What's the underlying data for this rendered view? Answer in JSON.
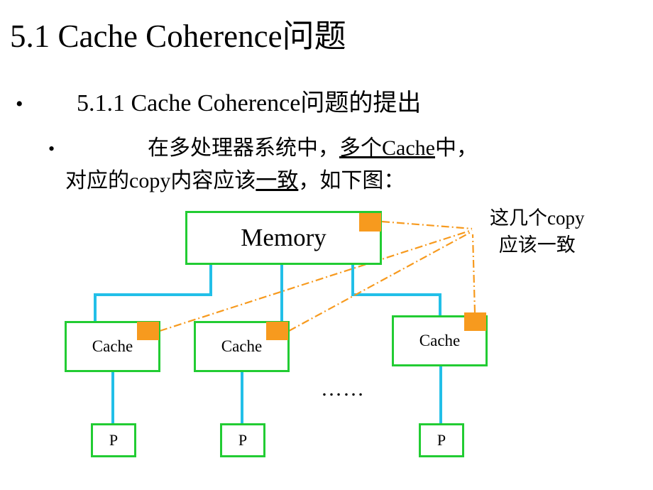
{
  "slide": {
    "title": "5.1 Cache Coherence问题",
    "bullets": [
      {
        "level": 1,
        "marker": "•",
        "text": "5.1.1 Cache Coherence问题的提出"
      },
      {
        "level": 2,
        "marker": "•",
        "line1_a": "在多处理器系统中，",
        "line1_underlined": "多个Cache",
        "line1_b": "中，",
        "line2_a": "对应的copy内容应该",
        "line2_underlined": "一致",
        "line2_b": "，如下图："
      }
    ]
  },
  "diagram": {
    "memory": {
      "label": "Memory"
    },
    "caches": [
      {
        "label": "Cache"
      },
      {
        "label": "Cache"
      },
      {
        "label": "Cache"
      }
    ],
    "processors": [
      {
        "label": "P"
      },
      {
        "label": "P"
      },
      {
        "label": "P"
      }
    ],
    "ellipsis": "……",
    "annotation": {
      "line1": "这几个copy",
      "line2": "应该一致"
    },
    "colors": {
      "node_border": "#22cc33",
      "connector": "#22bfe8",
      "copy_marker": "#f79a1e",
      "callout_line": "#f79a1e",
      "text": "#000000",
      "background": "#ffffff"
    }
  }
}
